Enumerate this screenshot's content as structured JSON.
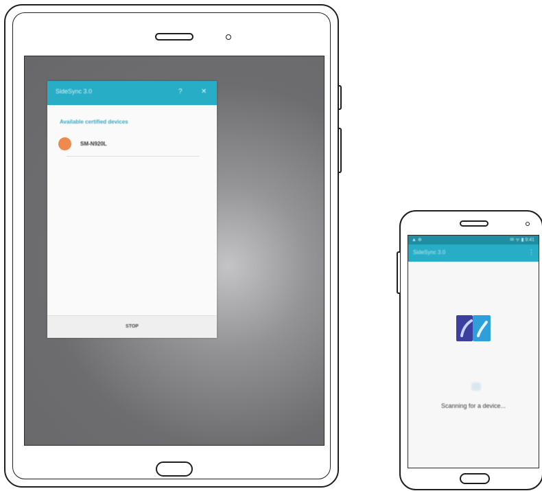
{
  "tablet": {
    "dialog": {
      "title": "SideSync 3.0",
      "help_icon": "?",
      "close_icon": "✕",
      "section_label": "Available certified devices",
      "devices": [
        {
          "name": "SM-N920L",
          "avatar_color": "#ee8a4e"
        }
      ],
      "stop_label": "STOP"
    }
  },
  "phone": {
    "status_left": "▲ ⊕",
    "status_right": "✉ ᯤ ▮ 9:41",
    "title": "SideSync 3.0",
    "menu_icon": "⋮",
    "icon": "sidesync-transfer-icon",
    "scan_text": "Scanning for a device..."
  },
  "colors": {
    "accent": "#27aec6",
    "status_bar": "#1f8ea2",
    "avatar": "#ee8a4e"
  }
}
